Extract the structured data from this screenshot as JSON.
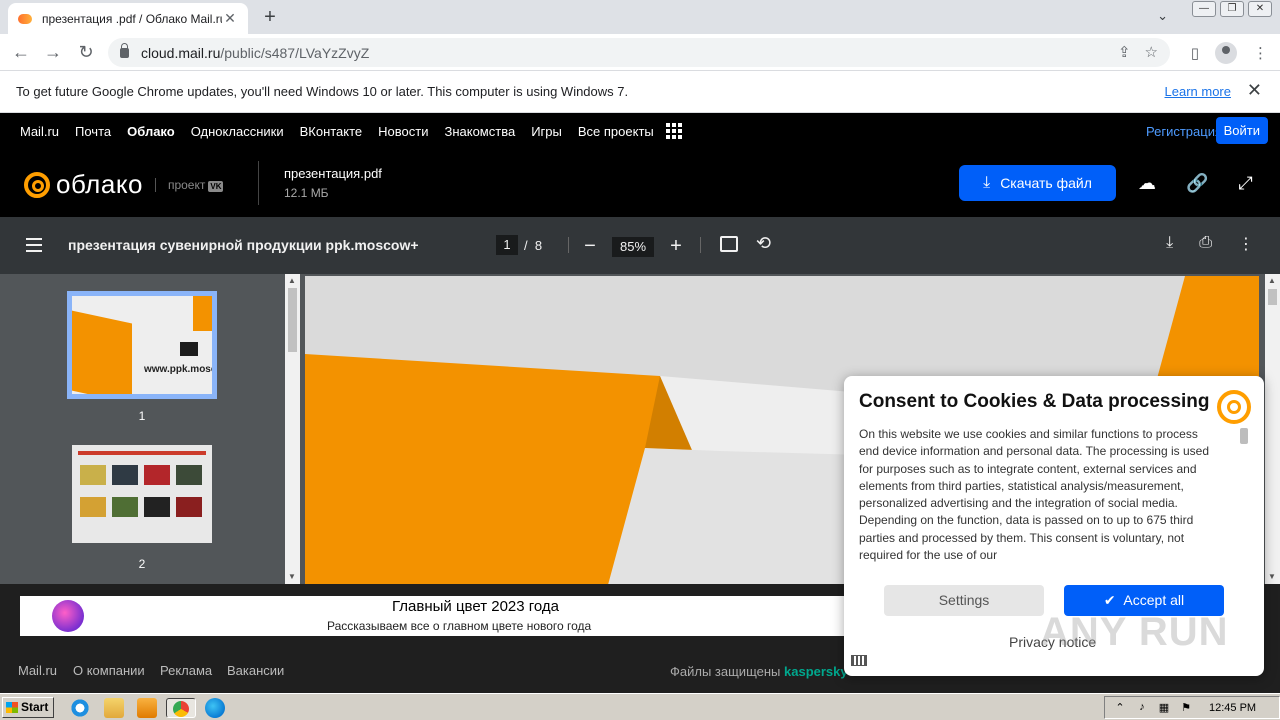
{
  "browser": {
    "tab_title": "презентация .pdf / Облако Mail.ru",
    "url_host": "cloud.mail.ru",
    "url_path": "/public/s487/LVaYzZvyZ",
    "infobar_text": "To get future Google Chrome updates, you'll need Windows 10 or later. This computer is using Windows 7.",
    "infobar_link": "Learn more"
  },
  "portal_nav": {
    "items": [
      "Mail.ru",
      "Почта",
      "Облако",
      "Одноклассники",
      "ВКонтакте",
      "Новости",
      "Знакомства",
      "Игры",
      "Все проекты"
    ],
    "register": "Регистрация",
    "login": "Войти"
  },
  "cloud_header": {
    "logo_text": "облако",
    "project_label": "проект",
    "project_badge": "VK",
    "file_name": "презентация.pdf",
    "file_size": "12.1 МБ",
    "download_label": "Скачать файл"
  },
  "pdf_viewer": {
    "doc_title": "презентация сувенирной продукции ppk.moscow+",
    "current_page": "1",
    "page_sep": "/",
    "total_pages": "8",
    "zoom": "85%",
    "thumbnails": [
      {
        "number": "1",
        "caption": "www.ppk.moscow"
      },
      {
        "number": "2"
      }
    ]
  },
  "promo": {
    "title": "Главный цвет 2023 года",
    "subtitle": "Рассказываем все о главном цвете нового года"
  },
  "footer": {
    "links": [
      "Mail.ru",
      "О компании",
      "Реклама",
      "Вакансии"
    ],
    "protected_prefix": "Файлы защищены",
    "protected_brand": "kaspersky"
  },
  "consent": {
    "title": "Consent to Cookies & Data processing",
    "body": "On this website we use cookies and similar functions to process end device information and personal data. The processing is used for purposes such as to integrate content, external services and elements from third parties, statistical analysis/measurement, personalized advertising and the integration of social media. Depending on the function, data is passed on to up to 675 third parties and processed by them. This consent is voluntary, not required for the use of our",
    "settings_label": "Settings",
    "accept_label": "Accept all",
    "privacy_label": "Privacy notice"
  },
  "watermark": "ANY RUN",
  "taskbar": {
    "start_label": "Start",
    "clock": "12:45 PM"
  },
  "colors": {
    "accent_blue": "#005ff9",
    "brand_orange": "#ff9e00",
    "slide_orange": "#f39200"
  }
}
